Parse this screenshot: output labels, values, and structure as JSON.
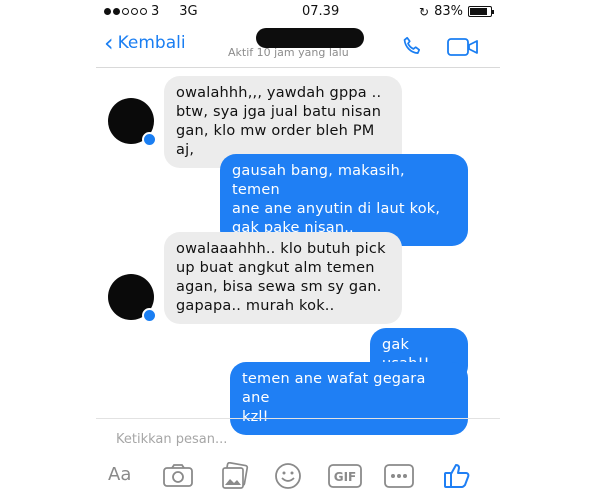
{
  "status_bar": {
    "carrier": "3",
    "network": "3G",
    "time": "07.39",
    "battery": "83%",
    "battery_level": 0.83
  },
  "header": {
    "back_label": "Kembali",
    "active_status": "Aktif 10 jam yang lalu"
  },
  "messages": [
    {
      "direction": "incoming",
      "text": "owalahhh,,, yawdah gppa ..\nbtw, sya jga jual batu nisan\ngan, klo mw order bleh PM aj,"
    },
    {
      "direction": "outgoing",
      "text": "gausah bang, makasih, temen\nane ane anyutin di laut kok,\ngak pake nisan.."
    },
    {
      "direction": "incoming",
      "text": "owalaaahhh.. klo butuh pick\nup buat angkut alm temen\nagan, bisa sewa sm sy gan.\ngapapa.. murah kok.."
    },
    {
      "direction": "outgoing",
      "text": "gak usah!!"
    },
    {
      "direction": "outgoing",
      "text": "temen ane wafat gegara ane\nkzl!"
    }
  ],
  "composer": {
    "placeholder": "Ketikkan pesan..."
  },
  "toolbar": {
    "text_format_label": "Aa",
    "gif_label": "GIF"
  },
  "colors": {
    "accent": "#1f7ff4",
    "incoming_bubble": "#ececec"
  }
}
